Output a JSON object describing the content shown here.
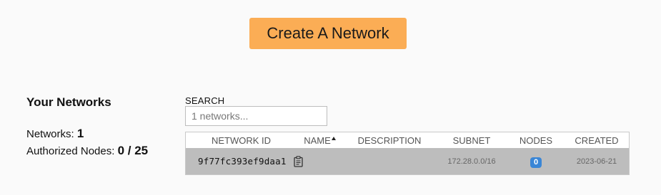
{
  "create_button": {
    "label": "Create A Network"
  },
  "summary": {
    "heading": "Your Networks",
    "networks_label": "Networks:",
    "networks_value": "1",
    "authorized_label": "Authorized Nodes:",
    "authorized_value": "0 / 25"
  },
  "search": {
    "label": "SEARCH",
    "placeholder": "1 networks..."
  },
  "table": {
    "columns": {
      "network_id": "NETWORK ID",
      "name": "NAME",
      "description": "DESCRIPTION",
      "subnet": "SUBNET",
      "nodes": "NODES",
      "created": "CREATED"
    },
    "sort_icon": "sort-ascending-icon",
    "rows": [
      {
        "network_id": "9f77fc393ef9daa1",
        "copy_icon": "clipboard-icon",
        "name": "",
        "description": "",
        "subnet": "172.28.0.0/16",
        "nodes": "0",
        "created": "2023-06-21"
      }
    ]
  },
  "colors": {
    "background": "#fafafa",
    "create_button": "#fbad55",
    "row_background": "#bdbdbd",
    "nodes_badge": "#3a86d6"
  }
}
